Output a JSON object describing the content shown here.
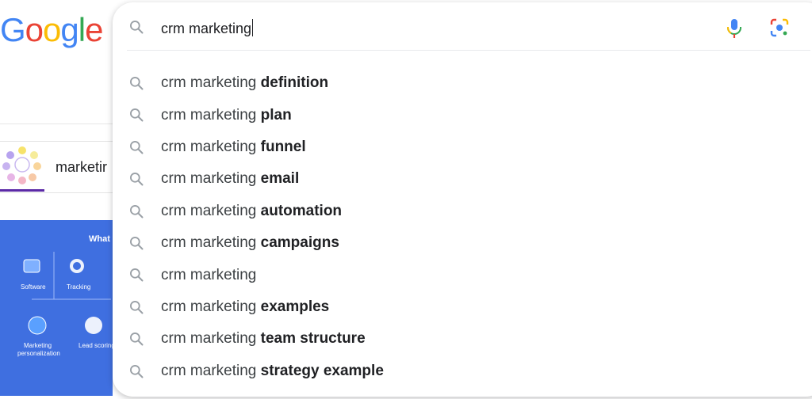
{
  "logo": {
    "letters": [
      "G",
      "o",
      "o",
      "g",
      "l",
      "e"
    ],
    "colors": [
      "#4285F4",
      "#EA4335",
      "#FBBC05",
      "#4285F4",
      "#34A853",
      "#EA4335"
    ]
  },
  "background": {
    "card_text": "marketir",
    "blue_heading": "What",
    "blue_labels": [
      "Software",
      "Tracking",
      "Marketing",
      "personalization",
      "Lead scoring"
    ]
  },
  "search": {
    "query": "crm marketing",
    "icons": [
      "search-icon",
      "mic-icon",
      "camera-lens-icon"
    ]
  },
  "suggestions": [
    {
      "prefix": "crm marketing ",
      "completion": "definition"
    },
    {
      "prefix": "crm marketing ",
      "completion": "plan"
    },
    {
      "prefix": "crm marketing ",
      "completion": "funnel"
    },
    {
      "prefix": "crm marketing ",
      "completion": "email"
    },
    {
      "prefix": "crm marketing ",
      "completion": "automation"
    },
    {
      "prefix": "crm marketing ",
      "completion": "campaigns"
    },
    {
      "prefix": "crm marketing",
      "completion": ""
    },
    {
      "prefix": "crm marketing ",
      "completion": "examples"
    },
    {
      "prefix": "crm marketing ",
      "completion": "team structure"
    },
    {
      "prefix": "crm marketing ",
      "completion": "strategy example"
    }
  ]
}
